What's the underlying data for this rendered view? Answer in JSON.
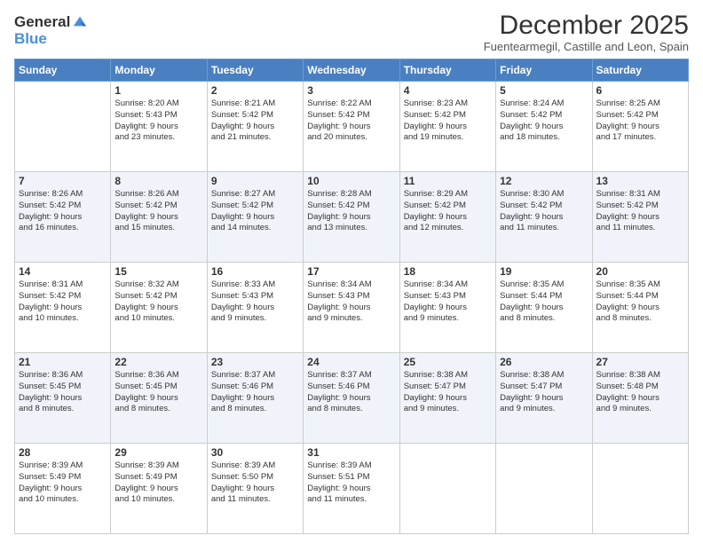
{
  "logo": {
    "general": "General",
    "blue": "Blue"
  },
  "title": "December 2025",
  "subtitle": "Fuentearmegil, Castille and Leon, Spain",
  "weekdays": [
    "Sunday",
    "Monday",
    "Tuesday",
    "Wednesday",
    "Thursday",
    "Friday",
    "Saturday"
  ],
  "weeks": [
    [
      {
        "day": "",
        "info": ""
      },
      {
        "day": "1",
        "info": "Sunrise: 8:20 AM\nSunset: 5:43 PM\nDaylight: 9 hours\nand 23 minutes."
      },
      {
        "day": "2",
        "info": "Sunrise: 8:21 AM\nSunset: 5:42 PM\nDaylight: 9 hours\nand 21 minutes."
      },
      {
        "day": "3",
        "info": "Sunrise: 8:22 AM\nSunset: 5:42 PM\nDaylight: 9 hours\nand 20 minutes."
      },
      {
        "day": "4",
        "info": "Sunrise: 8:23 AM\nSunset: 5:42 PM\nDaylight: 9 hours\nand 19 minutes."
      },
      {
        "day": "5",
        "info": "Sunrise: 8:24 AM\nSunset: 5:42 PM\nDaylight: 9 hours\nand 18 minutes."
      },
      {
        "day": "6",
        "info": "Sunrise: 8:25 AM\nSunset: 5:42 PM\nDaylight: 9 hours\nand 17 minutes."
      }
    ],
    [
      {
        "day": "7",
        "info": "Sunrise: 8:26 AM\nSunset: 5:42 PM\nDaylight: 9 hours\nand 16 minutes."
      },
      {
        "day": "8",
        "info": "Sunrise: 8:26 AM\nSunset: 5:42 PM\nDaylight: 9 hours\nand 15 minutes."
      },
      {
        "day": "9",
        "info": "Sunrise: 8:27 AM\nSunset: 5:42 PM\nDaylight: 9 hours\nand 14 minutes."
      },
      {
        "day": "10",
        "info": "Sunrise: 8:28 AM\nSunset: 5:42 PM\nDaylight: 9 hours\nand 13 minutes."
      },
      {
        "day": "11",
        "info": "Sunrise: 8:29 AM\nSunset: 5:42 PM\nDaylight: 9 hours\nand 12 minutes."
      },
      {
        "day": "12",
        "info": "Sunrise: 8:30 AM\nSunset: 5:42 PM\nDaylight: 9 hours\nand 11 minutes."
      },
      {
        "day": "13",
        "info": "Sunrise: 8:31 AM\nSunset: 5:42 PM\nDaylight: 9 hours\nand 11 minutes."
      }
    ],
    [
      {
        "day": "14",
        "info": "Sunrise: 8:31 AM\nSunset: 5:42 PM\nDaylight: 9 hours\nand 10 minutes."
      },
      {
        "day": "15",
        "info": "Sunrise: 8:32 AM\nSunset: 5:42 PM\nDaylight: 9 hours\nand 10 minutes."
      },
      {
        "day": "16",
        "info": "Sunrise: 8:33 AM\nSunset: 5:43 PM\nDaylight: 9 hours\nand 9 minutes."
      },
      {
        "day": "17",
        "info": "Sunrise: 8:34 AM\nSunset: 5:43 PM\nDaylight: 9 hours\nand 9 minutes."
      },
      {
        "day": "18",
        "info": "Sunrise: 8:34 AM\nSunset: 5:43 PM\nDaylight: 9 hours\nand 9 minutes."
      },
      {
        "day": "19",
        "info": "Sunrise: 8:35 AM\nSunset: 5:44 PM\nDaylight: 9 hours\nand 8 minutes."
      },
      {
        "day": "20",
        "info": "Sunrise: 8:35 AM\nSunset: 5:44 PM\nDaylight: 9 hours\nand 8 minutes."
      }
    ],
    [
      {
        "day": "21",
        "info": "Sunrise: 8:36 AM\nSunset: 5:45 PM\nDaylight: 9 hours\nand 8 minutes."
      },
      {
        "day": "22",
        "info": "Sunrise: 8:36 AM\nSunset: 5:45 PM\nDaylight: 9 hours\nand 8 minutes."
      },
      {
        "day": "23",
        "info": "Sunrise: 8:37 AM\nSunset: 5:46 PM\nDaylight: 9 hours\nand 8 minutes."
      },
      {
        "day": "24",
        "info": "Sunrise: 8:37 AM\nSunset: 5:46 PM\nDaylight: 9 hours\nand 8 minutes."
      },
      {
        "day": "25",
        "info": "Sunrise: 8:38 AM\nSunset: 5:47 PM\nDaylight: 9 hours\nand 9 minutes."
      },
      {
        "day": "26",
        "info": "Sunrise: 8:38 AM\nSunset: 5:47 PM\nDaylight: 9 hours\nand 9 minutes."
      },
      {
        "day": "27",
        "info": "Sunrise: 8:38 AM\nSunset: 5:48 PM\nDaylight: 9 hours\nand 9 minutes."
      }
    ],
    [
      {
        "day": "28",
        "info": "Sunrise: 8:39 AM\nSunset: 5:49 PM\nDaylight: 9 hours\nand 10 minutes."
      },
      {
        "day": "29",
        "info": "Sunrise: 8:39 AM\nSunset: 5:49 PM\nDaylight: 9 hours\nand 10 minutes."
      },
      {
        "day": "30",
        "info": "Sunrise: 8:39 AM\nSunset: 5:50 PM\nDaylight: 9 hours\nand 11 minutes."
      },
      {
        "day": "31",
        "info": "Sunrise: 8:39 AM\nSunset: 5:51 PM\nDaylight: 9 hours\nand 11 minutes."
      },
      {
        "day": "",
        "info": ""
      },
      {
        "day": "",
        "info": ""
      },
      {
        "day": "",
        "info": ""
      }
    ]
  ]
}
